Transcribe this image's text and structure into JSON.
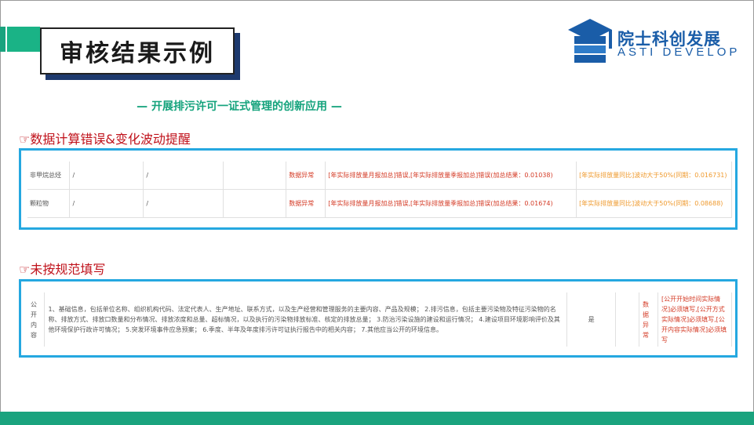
{
  "header": {
    "title": "审核结果示例",
    "subtitle": "— 开展排污许可一证式管理的创新应用 —",
    "logo_cn": "院士科创发展",
    "logo_en": "ASTI DEVELOP"
  },
  "section1": {
    "title": "☞数据计算错误&变化波动提醒",
    "rows": [
      {
        "name": "非甲烷总烃",
        "c2": "/",
        "c3": "/",
        "c4": "",
        "status": "数据异常",
        "error": "[年实际排放量月报加总]错误,[年实际排放量季报加总]错误(加总结果：0.01038)",
        "warning": "[年实际排放量同比]波动大于50%(同期：0.016731)"
      },
      {
        "name": "颗粒物",
        "c2": "/",
        "c3": "/",
        "c4": "",
        "status": "数据异常",
        "error": "[年实际排放量月报加总]错误,[年实际排放量季报加总]错误(加总结果：0.01674)",
        "warning": "[年实际排放量同比]波动大于50%(同期：0.08688)"
      }
    ]
  },
  "section2": {
    "title": "☞未按规范填写",
    "row": {
      "name": "公开内容",
      "content": "1、基础信息，包括单位名称、组织机构代码、法定代表人、生产地址、联系方式，以及生产经营和管理服务的主要内容、产品及规模； 2.排污信息，包括主要污染物及特征污染物的名称、排放方式、排放口数量和分布情况、排放浓度和总量、超标情况，以及执行的污染物排放标准、核定的排放总量； 3.防治污染设施的建设和运行情况； 4.建设项目环境影响评价及其他环境保护行政许可情况； 5.突发环境事件应急预案； 6.季度、半年及年度排污许可证执行报告中的相关内容； 7.其他应当公开的环境信息。",
      "flag": "是",
      "status": "数据异常",
      "error": "[公开开始时间实际情况]必须填写,[公开方式实际情况]必须填写,[公开内容实际情况]必须填写"
    }
  },
  "colors": {
    "accent_green": "#1aa37e",
    "panel_border": "#25a8e0",
    "error_red": "#d43b26",
    "warning_orange": "#ef9a2e",
    "logo_blue": "#1a5da8"
  }
}
